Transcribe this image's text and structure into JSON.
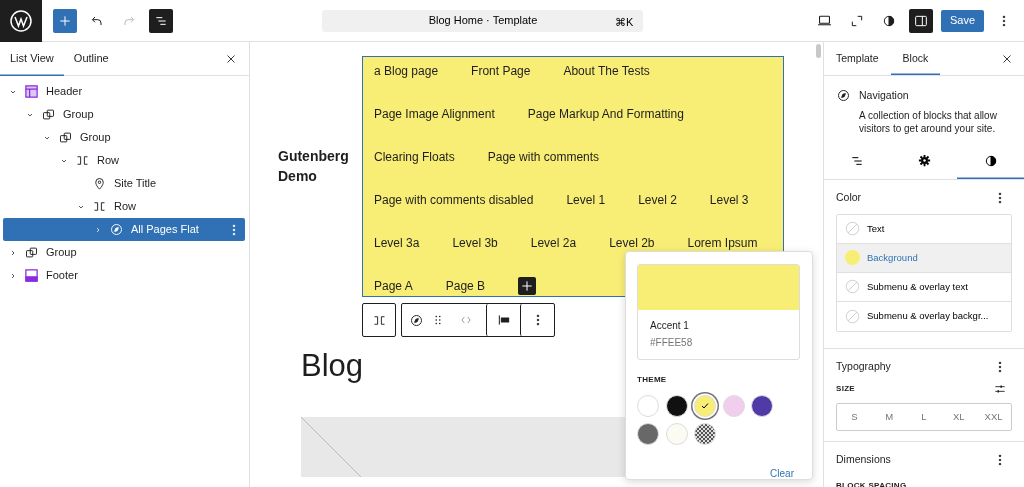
{
  "top_bar": {
    "undo": {
      "disabled": false
    },
    "redo": {
      "disabled": true
    },
    "list_view_open": true,
    "command_bar": {
      "title": "Blog Home · Template",
      "shortcut": "⌘K"
    },
    "settings_open": true,
    "save_button": "Save"
  },
  "left_panel": {
    "tabs": [
      {
        "label": "List View",
        "selected": true
      },
      {
        "label": "Outline",
        "selected": false
      }
    ],
    "tree": [
      {
        "label": "Header",
        "kind": "header",
        "expanded": true,
        "selected": false,
        "children": [
          {
            "label": "Group",
            "kind": "group",
            "expanded": true,
            "selected": false,
            "children": [
              {
                "label": "Group",
                "kind": "group",
                "expanded": true,
                "selected": false,
                "children": [
                  {
                    "label": "Row",
                    "kind": "row",
                    "expanded": true,
                    "selected": false,
                    "children": [
                      {
                        "label": "Site Title",
                        "kind": "site-title",
                        "selected": false
                      },
                      {
                        "label": "Row",
                        "kind": "row",
                        "expanded": true,
                        "selected": false,
                        "children": [
                          {
                            "label": "All Pages Flat",
                            "kind": "navigation",
                            "expanded": false,
                            "selected": true
                          }
                        ]
                      }
                    ]
                  }
                ]
              }
            ]
          }
        ]
      },
      {
        "label": "Group",
        "kind": "group",
        "expanded": false,
        "selected": false
      },
      {
        "label": "Footer",
        "kind": "footer",
        "expanded": false,
        "selected": false
      }
    ]
  },
  "canvas": {
    "site_title": "Gutenberg Demo",
    "navigation": {
      "items": [
        {
          "label": "a Blog page"
        },
        {
          "label": "Front Page"
        },
        {
          "label": "About The Tests"
        },
        {
          "label": "Page Image Alignment"
        },
        {
          "label": "Page Markup And Formatting"
        },
        {
          "label": "Clearing Floats"
        },
        {
          "label": "Page with comments"
        },
        {
          "label": "Page with comments disabled"
        },
        {
          "label": "Level 1"
        },
        {
          "label": "Level 2"
        },
        {
          "label": "Level 3"
        },
        {
          "label": "Level 3a"
        },
        {
          "label": "Level 3b"
        },
        {
          "label": "Level 2a"
        },
        {
          "label": "Level 2b"
        },
        {
          "label": "Lorem Ipsum"
        },
        {
          "label": "Page A"
        },
        {
          "label": "Page B"
        }
      ]
    },
    "heading": "Blog",
    "color_popover": {
      "color_name": "Accent 1",
      "color_value": "#FFEE58",
      "section": "THEME",
      "clear": "Clear",
      "swatches": [
        {
          "kind": "solid",
          "color": "#ffffff",
          "selected": false
        },
        {
          "kind": "solid",
          "color": "#111111",
          "selected": false
        },
        {
          "kind": "solid",
          "color": "#f9ee75",
          "selected": true
        },
        {
          "kind": "solid",
          "color": "#f1cdee",
          "selected": false
        },
        {
          "kind": "solid",
          "color": "#503aa8",
          "selected": false
        },
        {
          "kind": "solid",
          "color": "#686868",
          "selected": false
        },
        {
          "kind": "solid",
          "color": "#fbfaf3",
          "selected": false
        },
        {
          "kind": "pattern",
          "selected": false
        }
      ]
    }
  },
  "right_panel": {
    "tabs": [
      {
        "label": "Template",
        "selected": false
      },
      {
        "label": "Block",
        "selected": true
      }
    ],
    "block": {
      "title": "Navigation",
      "description": "A collection of blocks that allow visitors to get around your site."
    },
    "inspector_tabs": [
      {
        "kind": "list",
        "selected": false
      },
      {
        "kind": "settings",
        "selected": false
      },
      {
        "kind": "styles",
        "selected": true
      }
    ],
    "color": {
      "title": "Color",
      "items": [
        {
          "label": "Text",
          "selected": false
        },
        {
          "label": "Background",
          "selected": true,
          "color": "#f9ee75"
        },
        {
          "label": "Submenu & overlay text",
          "selected": false
        },
        {
          "label": "Submenu & overlay backgr...",
          "selected": false
        }
      ]
    },
    "typography": {
      "title": "Typography",
      "size_label": "SIZE",
      "sizes": [
        {
          "label": "S"
        },
        {
          "label": "M"
        },
        {
          "label": "L"
        },
        {
          "label": "XL"
        },
        {
          "label": "XXL"
        }
      ]
    },
    "dimensions": {
      "title": "Dimensions",
      "block_spacing_label": "BLOCK SPACING"
    }
  }
}
